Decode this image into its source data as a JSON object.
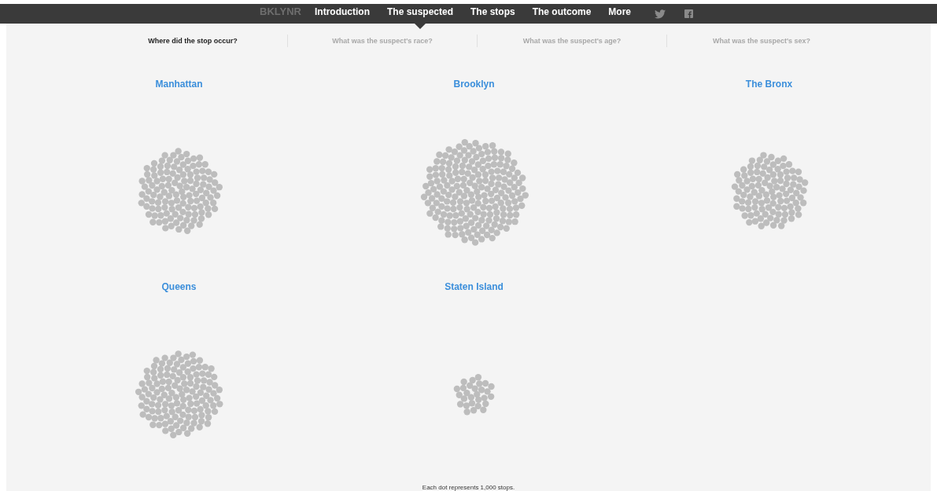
{
  "nav": {
    "logo": "BKLYNR",
    "items": [
      {
        "label": "Introduction",
        "selected": false
      },
      {
        "label": "The suspected",
        "selected": true
      },
      {
        "label": "The stops",
        "selected": false
      },
      {
        "label": "The outcome",
        "selected": false
      },
      {
        "label": "More",
        "selected": false
      }
    ]
  },
  "questions": [
    {
      "label": "Where did the stop occur?",
      "selected": true
    },
    {
      "label": "What was the suspect's race?",
      "selected": false
    },
    {
      "label": "What was the suspect's age?",
      "selected": false
    },
    {
      "label": "What was the suspect's sex?",
      "selected": false
    }
  ],
  "boroughs": [
    {
      "name": "Manhattan",
      "kind": "medium"
    },
    {
      "name": "Brooklyn",
      "kind": "large"
    },
    {
      "name": "The Bronx",
      "kind": "small"
    },
    {
      "name": "Queens",
      "kind": "medium-plus"
    },
    {
      "name": "Staten Island",
      "kind": "tiny"
    }
  ],
  "footnote": "Each dot represents 1,000 stops."
}
